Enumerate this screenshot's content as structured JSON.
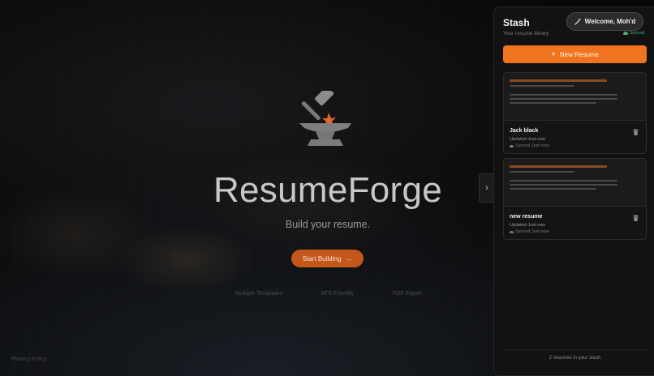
{
  "hero": {
    "title": "ResumeForge",
    "tagline": "Build your resume.",
    "start_label": "Start Building",
    "start_arrow": "→",
    "features": [
      "Multiple Templates",
      "ATS-Friendly",
      "PDF Export"
    ],
    "separator": "·",
    "privacy": "Privacy Policy"
  },
  "panel": {
    "title": "Stash",
    "subtitle": "Your resume library",
    "welcome": "Welcome, Moh'd",
    "synced": "Synced",
    "new_resume": "New Resume",
    "new_resume_icon": "+",
    "collapse_icon": "›",
    "resumes": [
      {
        "name": "Jack black",
        "updated": "Updated Just now",
        "synced": "Synced Just now"
      },
      {
        "name": "new resume",
        "updated": "Updated Just now",
        "synced": "Synced Just now"
      }
    ],
    "count": "2 resumes in your stash"
  },
  "colors": {
    "accent": "#f0731f",
    "start_button": "#c4561b",
    "synced_green": "#4bb36b"
  },
  "icons": {
    "logo": "anvil-hammer-icon",
    "welcome": "magic-wand-icon",
    "delete": "trash-icon",
    "sync": "cloud-icon",
    "collapse": "chevron-right-icon"
  }
}
